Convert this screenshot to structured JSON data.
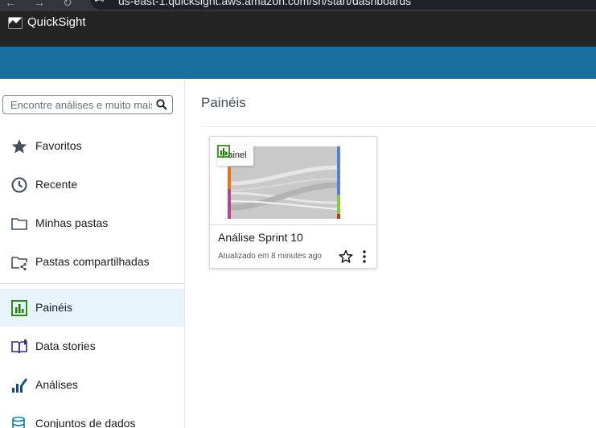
{
  "browser": {
    "url": "us-east-1.quicksight.aws.amazon.com/sn/start/dashboards"
  },
  "app": {
    "name": "QuickSight"
  },
  "colors": {
    "header": "#232323",
    "band": "#1a6e9c",
    "active_bg": "#e7f4fb",
    "accent_green": "#1d8102"
  },
  "sidebar": {
    "search_placeholder": "Encontre análises e muito mais",
    "items": [
      {
        "label": "Favoritos",
        "icon": "star-icon"
      },
      {
        "label": "Recente",
        "icon": "clock-icon"
      },
      {
        "label": "Minhas pastas",
        "icon": "folder-icon"
      },
      {
        "label": "Pastas compartilhadas",
        "icon": "shared-folder-icon"
      },
      {
        "label": "Painéis",
        "icon": "dashboard-icon",
        "active": true
      },
      {
        "label": "Data stories",
        "icon": "book-icon"
      },
      {
        "label": "Análises",
        "icon": "analysis-icon"
      },
      {
        "label": "Conjuntos de dados",
        "icon": "database-icon"
      }
    ]
  },
  "main": {
    "title": "Painéis",
    "cards": [
      {
        "badge": "Painel",
        "title": "Análise Sprint 10",
        "updated": "Atualizado em 8 minutes ago"
      }
    ]
  }
}
